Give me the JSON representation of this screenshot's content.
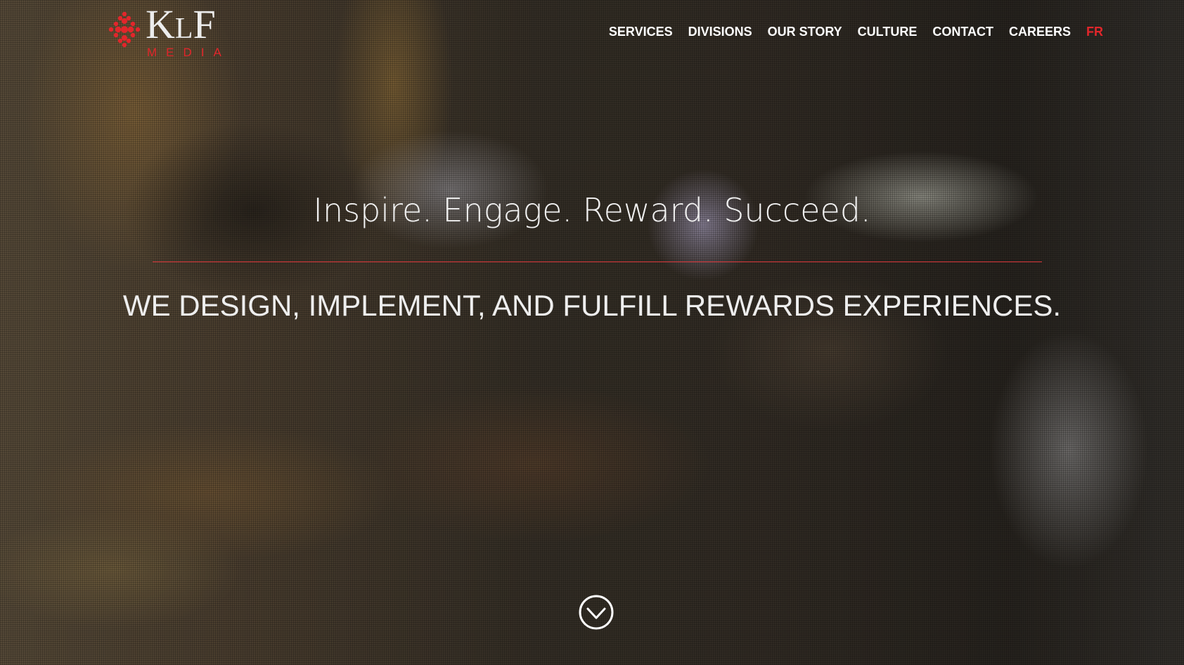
{
  "logo": {
    "main": "K",
    "small": "L",
    "end": "F",
    "sub": "MEDIA"
  },
  "nav": {
    "items": [
      {
        "label": "SERVICES"
      },
      {
        "label": "DIVISIONS"
      },
      {
        "label": "OUR STORY"
      },
      {
        "label": "CULTURE"
      },
      {
        "label": "CONTACT"
      },
      {
        "label": "CAREERS"
      }
    ],
    "lang": "FR"
  },
  "hero": {
    "headline": "Inspire. Engage. Reward. Succeed.",
    "tagline": "WE DESIGN, IMPLEMENT, AND FULFILL REWARDS EXPERIENCES."
  },
  "colors": {
    "accent": "#e2262b",
    "text": "#ffffff"
  },
  "icons": {
    "logo_mark": "red-dot-cluster-icon",
    "scroll": "chevron-down-circle-icon"
  }
}
